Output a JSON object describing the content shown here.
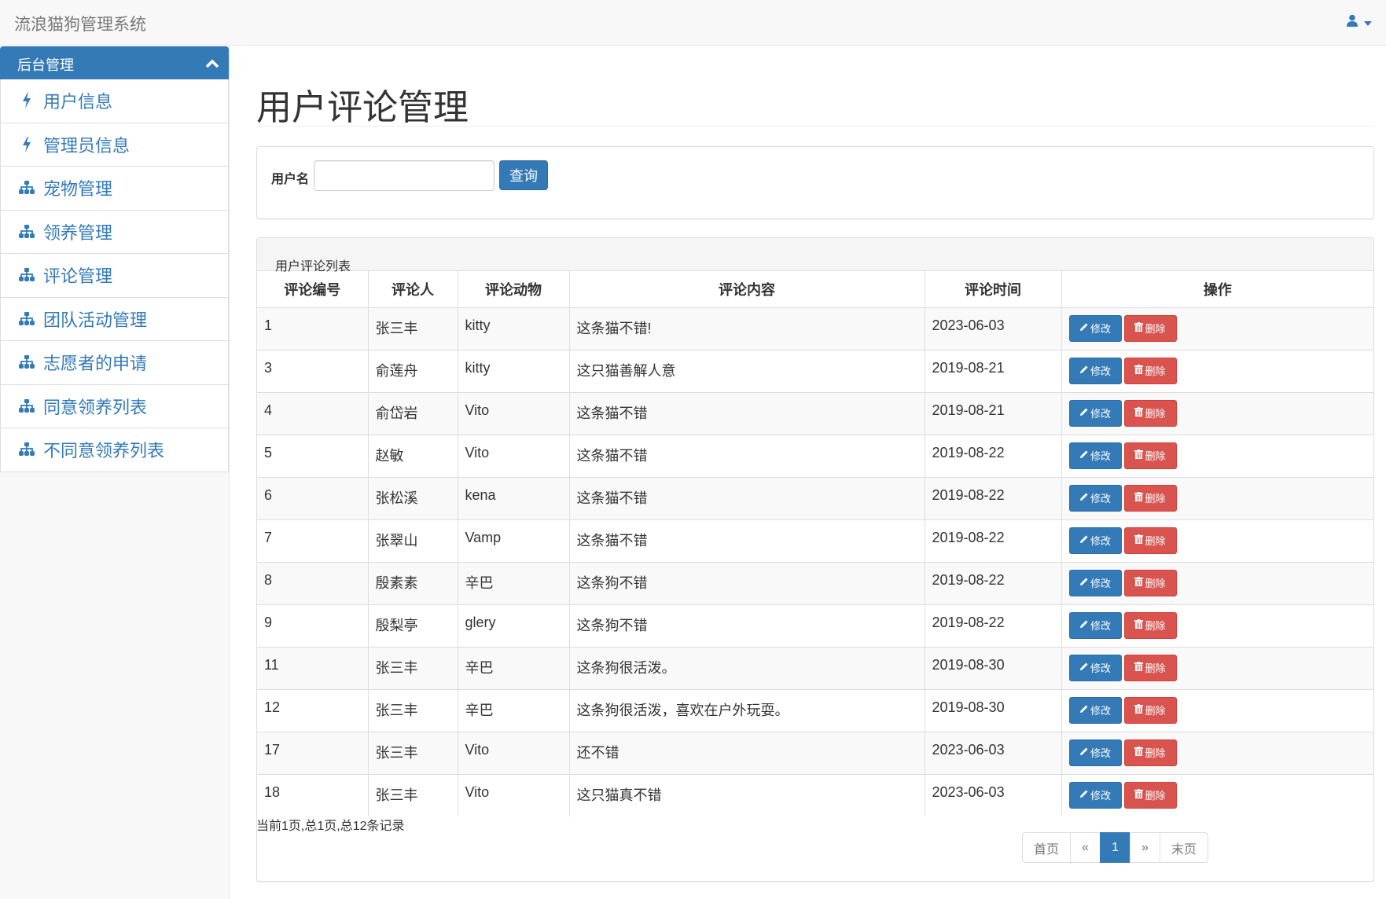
{
  "navbar": {
    "brand": "流浪猫狗管理系统",
    "user_icon": "user-icon",
    "caret_icon": "caret-down-icon"
  },
  "sidebar": {
    "heading": "后台管理",
    "heading_icon": "chevron-up-icon",
    "items": [
      {
        "label": "用户信息",
        "icon": "bolt-icon"
      },
      {
        "label": "管理员信息",
        "icon": "bolt-icon"
      },
      {
        "label": "宠物管理",
        "icon": "sitemap-icon"
      },
      {
        "label": "领养管理",
        "icon": "sitemap-icon"
      },
      {
        "label": "评论管理",
        "icon": "sitemap-icon"
      },
      {
        "label": "团队活动管理",
        "icon": "sitemap-icon"
      },
      {
        "label": "志愿者的申请",
        "icon": "sitemap-icon"
      },
      {
        "label": "同意领养列表",
        "icon": "sitemap-icon"
      },
      {
        "label": "不同意领养列表",
        "icon": "sitemap-icon"
      }
    ]
  },
  "main": {
    "title": "用户评论管理",
    "search": {
      "label": "用户名",
      "value": "",
      "placeholder": "",
      "button": "查询"
    },
    "list": {
      "heading": "用户评论列表",
      "columns": [
        "评论编号",
        "评论人",
        "评论动物",
        "评论内容",
        "评论时间",
        "操作"
      ],
      "edit_label": "修改",
      "delete_label": "删除",
      "rows": [
        {
          "id": "1",
          "user": "张三丰",
          "animal": "kitty",
          "content": "这条猫不错!",
          "time": "2023-06-03"
        },
        {
          "id": "3",
          "user": "俞莲舟",
          "animal": "kitty",
          "content": "这只猫善解人意",
          "time": "2019-08-21"
        },
        {
          "id": "4",
          "user": "俞岱岩",
          "animal": "Vito",
          "content": "这条猫不错",
          "time": "2019-08-21"
        },
        {
          "id": "5",
          "user": "赵敏",
          "animal": "Vito",
          "content": "这条猫不错",
          "time": "2019-08-22"
        },
        {
          "id": "6",
          "user": "张松溪",
          "animal": "kena",
          "content": "这条猫不错",
          "time": "2019-08-22"
        },
        {
          "id": "7",
          "user": "张翠山",
          "animal": "Vamp",
          "content": "这条猫不错",
          "time": "2019-08-22"
        },
        {
          "id": "8",
          "user": "殷素素",
          "animal": "辛巴",
          "content": "这条狗不错",
          "time": "2019-08-22"
        },
        {
          "id": "9",
          "user": "殷梨亭",
          "animal": "glery",
          "content": "这条狗不错",
          "time": "2019-08-22"
        },
        {
          "id": "11",
          "user": "张三丰",
          "animal": "辛巴",
          "content": "这条狗很活泼。",
          "time": "2019-08-30"
        },
        {
          "id": "12",
          "user": "张三丰",
          "animal": "辛巴",
          "content": "这条狗很活泼，喜欢在户外玩耍。",
          "time": "2019-08-30"
        },
        {
          "id": "17",
          "user": "张三丰",
          "animal": "Vito",
          "content": "还不错",
          "time": "2023-06-03"
        },
        {
          "id": "18",
          "user": "张三丰",
          "animal": "Vito",
          "content": "这只猫真不错",
          "time": "2023-06-03"
        }
      ]
    },
    "page_info": "当前1页,总1页,总12条记录",
    "pagination": {
      "first": "首页",
      "prev": "«",
      "current": "1",
      "next": "»",
      "last": "末页"
    }
  },
  "colors": {
    "primary": "#337ab7",
    "danger": "#d9534f"
  }
}
